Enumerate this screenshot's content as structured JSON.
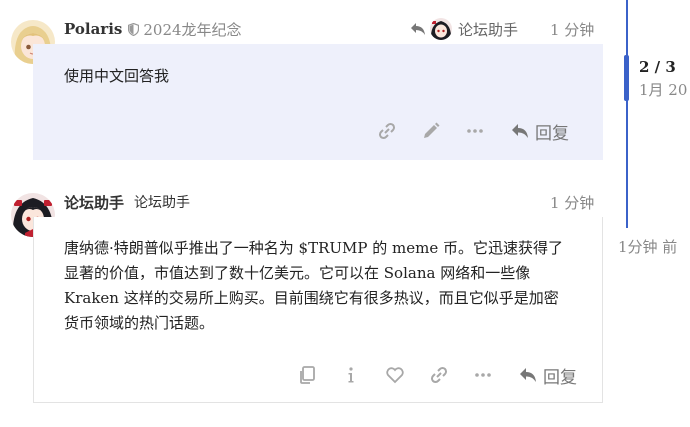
{
  "posts": [
    {
      "username": "Polaris",
      "title_badge": "2024龙年纪念",
      "reply_to": "论坛助手",
      "time": "1 分钟",
      "body": "使用中文回答我",
      "reply_label": "回复"
    },
    {
      "username": "论坛助手",
      "user_title": "论坛助手",
      "time": "1 分钟",
      "body_lines": [
        "唐纳德·特朗普似乎推出了一种名为 $TRUMP 的 meme 币。它迅速获得了",
        "显著的价值，市值达到了数十亿美元。它可以在 Solana 网络和一些像",
        "Kraken 这样的交易所上购买。目前围绕它有很多热议，而且它似乎是加密",
        "货币领域的热门话题。"
      ],
      "reply_label": "回复"
    }
  ],
  "timeline": {
    "position": "2 / 3",
    "date": "1月 20",
    "last_activity": "1分钟 前"
  },
  "colors": {
    "accent": "#3b62c9",
    "highlight_bg": "#eef0fb",
    "icon": "#a0a0a0"
  }
}
